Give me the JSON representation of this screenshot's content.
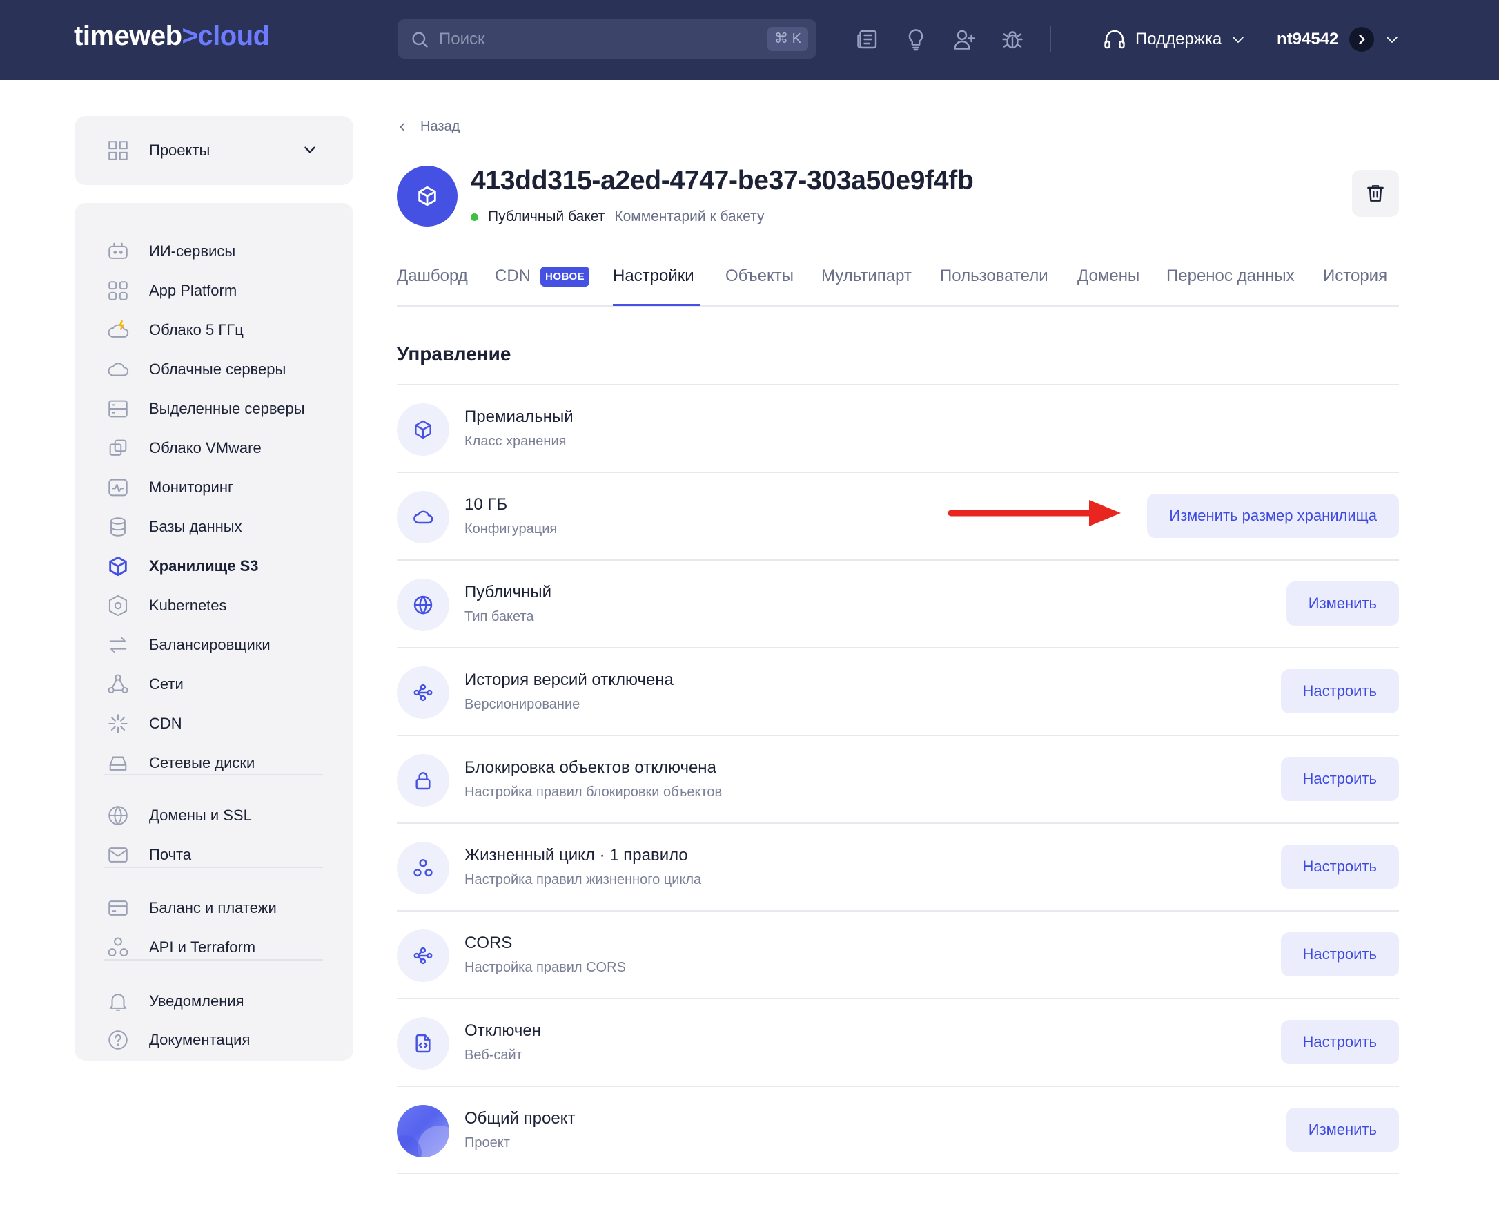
{
  "header": {
    "logo_main": "timeweb",
    "logo_sep": ">",
    "logo_accent": "cloud",
    "search_placeholder": "Поиск",
    "search_shortcut": "⌘ K",
    "icons": [
      "news-icon",
      "lightbulb-icon",
      "add-user-icon",
      "bug-icon"
    ],
    "support_label": "Поддержка",
    "username": "nt94542"
  },
  "sidebar": {
    "projects_label": "Проекты",
    "items": [
      {
        "label": "ИИ-сервисы",
        "icon": "robot-icon"
      },
      {
        "label": "App Platform",
        "icon": "grid-icon"
      },
      {
        "label": "Облако 5 ГГц",
        "icon": "cloud-bolt-icon"
      },
      {
        "label": "Облачные серверы",
        "icon": "cloud-icon"
      },
      {
        "label": "Выделенные серверы",
        "icon": "server-icon"
      },
      {
        "label": "Облако VMware",
        "icon": "vmware-icon"
      },
      {
        "label": "Мониторинг",
        "icon": "monitoring-icon"
      },
      {
        "label": "Базы данных",
        "icon": "database-icon"
      },
      {
        "label": "Хранилище S3",
        "icon": "cube-icon"
      },
      {
        "label": "Kubernetes",
        "icon": "kubernetes-icon"
      },
      {
        "label": "Балансировщики",
        "icon": "balancer-icon"
      },
      {
        "label": "Сети",
        "icon": "network-icon"
      },
      {
        "label": "CDN",
        "icon": "cdn-icon"
      },
      {
        "label": "Сетевые диски",
        "icon": "disk-icon"
      },
      {
        "label": "Домены и SSL",
        "icon": "globe-icon"
      },
      {
        "label": "Почта",
        "icon": "mail-icon"
      },
      {
        "label": "Баланс и платежи",
        "icon": "card-icon"
      },
      {
        "label": "API и Terraform",
        "icon": "api-icon"
      },
      {
        "label": "Уведомления",
        "icon": "bell-icon"
      },
      {
        "label": "Документация",
        "icon": "help-icon"
      }
    ],
    "active_item": "Хранилище S3"
  },
  "page": {
    "back_label": "Назад",
    "bucket_name": "413dd315-a2ed-4747-be37-303a50e9f4fb",
    "bucket_type": "Публичный бакет",
    "bucket_comment": "Комментарий к бакету",
    "status_color": "#3fbf3f"
  },
  "tabs": [
    {
      "label": "Дашборд"
    },
    {
      "label": "CDN",
      "badge": "НОВОЕ"
    },
    {
      "label": "Настройки",
      "active": true
    },
    {
      "label": "Объекты"
    },
    {
      "label": "Мультипарт"
    },
    {
      "label": "Пользователи"
    },
    {
      "label": "Домены"
    },
    {
      "label": "Перенос данных"
    },
    {
      "label": "История"
    }
  ],
  "management": {
    "title": "Управление",
    "rows": [
      {
        "title": "Премиальный",
        "subtitle": "Класс хранения",
        "icon": "cube-icon",
        "button": ""
      },
      {
        "title": "10 ГБ",
        "subtitle": "Конфигурация",
        "icon": "cloud-icon",
        "button": "Изменить размер хранилища"
      },
      {
        "title": "Публичный",
        "subtitle": "Тип бакета",
        "icon": "globe-icon",
        "button": "Изменить"
      },
      {
        "title": "История версий отключена",
        "subtitle": "Версионирование",
        "icon": "share-icon",
        "button": "Настроить"
      },
      {
        "title": "Блокировка объектов отключена",
        "subtitle": "Настройка правил блокировки объектов",
        "icon": "lock-icon",
        "button": "Настроить"
      },
      {
        "title": "Жизненный цикл · 1 правило",
        "subtitle": "Настройка правил жизненного цикла",
        "icon": "lifecycle-icon",
        "button": "Настроить"
      },
      {
        "title": "CORS",
        "subtitle": "Настройка правил CORS",
        "icon": "share-icon",
        "button": "Настроить"
      },
      {
        "title": "Отключен",
        "subtitle": "Веб-сайт",
        "icon": "code-file-icon",
        "button": "Настроить"
      },
      {
        "title": "Общий проект",
        "subtitle": "Проект",
        "icon": "project-avatar",
        "button": "Изменить"
      }
    ]
  },
  "colors": {
    "topbar": "#2a3257",
    "accent": "#4451e3",
    "button_bg": "#ecedfc",
    "annotation_arrow": "#e8261f"
  }
}
